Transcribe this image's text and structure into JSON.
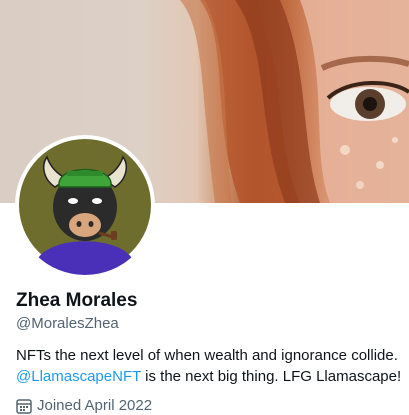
{
  "profile": {
    "name": "Zhea Morales",
    "handle": "@MoralesZhea",
    "bio_text_1": "NFTs the next level of when wealth and ignorance collide.",
    "bio_mention": "@LlamascapeNFT",
    "bio_text_2": " is the next big thing. LFG Llamascape!",
    "joined": "Joined April 2022"
  },
  "icons": {
    "joined_icon": "calendar-icon"
  },
  "colors": {
    "link": "#1d9bf0",
    "secondary_text": "#536471",
    "primary_text": "#0f1419",
    "avatar_bg": "#6e6d2e"
  }
}
